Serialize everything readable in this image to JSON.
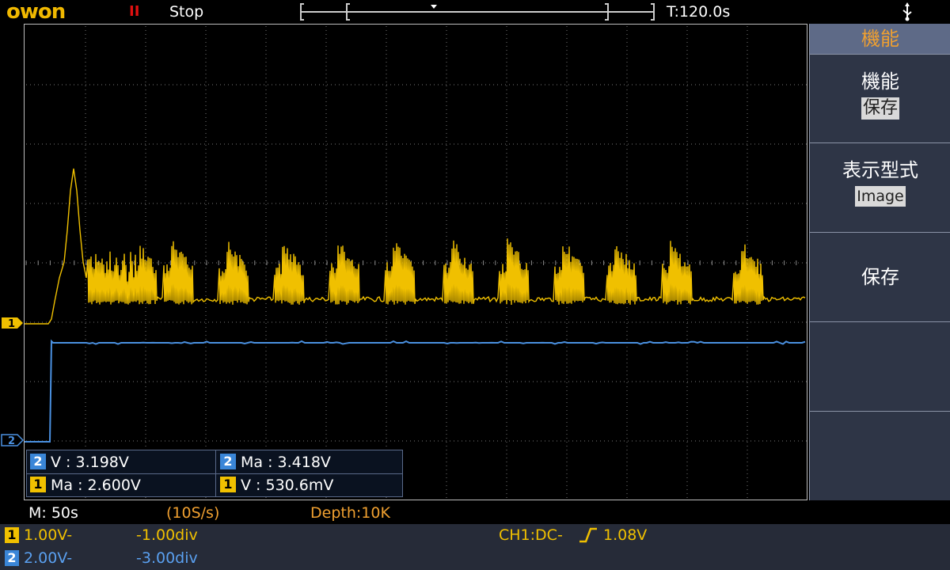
{
  "top": {
    "logo": "owon",
    "run_indicator": "II",
    "run_state": "Stop",
    "trigger_time": "T:120.0s"
  },
  "measurements": [
    {
      "channel": "2",
      "text": "V : 3.198V"
    },
    {
      "channel": "2",
      "text": "Ma : 3.418V"
    },
    {
      "channel": "1",
      "text": "Ma : 2.600V"
    },
    {
      "channel": "1",
      "text": "V : 530.6mV"
    }
  ],
  "menu": {
    "title": "機能",
    "sections": [
      {
        "label": "機能",
        "value": "保存"
      },
      {
        "label": "表示型式",
        "value": "Image"
      },
      {
        "label": "保存",
        "value": ""
      }
    ]
  },
  "status": {
    "timebase": "M: 50s",
    "sample_rate": "(10S/s)",
    "depth": "Depth:10K",
    "ch1_scale": "1.00V-",
    "ch1_offset": "-1.00div",
    "ch2_scale": "2.00V-",
    "ch2_offset": "-3.00div",
    "trigger": "CH1:DC-",
    "trigger_level": "1.08V",
    "ch1_tag": "1",
    "ch2_tag": "2"
  },
  "colors": {
    "ch1": "#f0c000",
    "ch2": "#3a86d8",
    "menu_title_text": "#f0a030",
    "menu_bg": "#2e3546"
  },
  "icons": [
    "pause-icon",
    "usb-icon",
    "rising-edge-icon",
    "channel-1-marker-icon",
    "channel-2-marker-icon"
  ]
}
